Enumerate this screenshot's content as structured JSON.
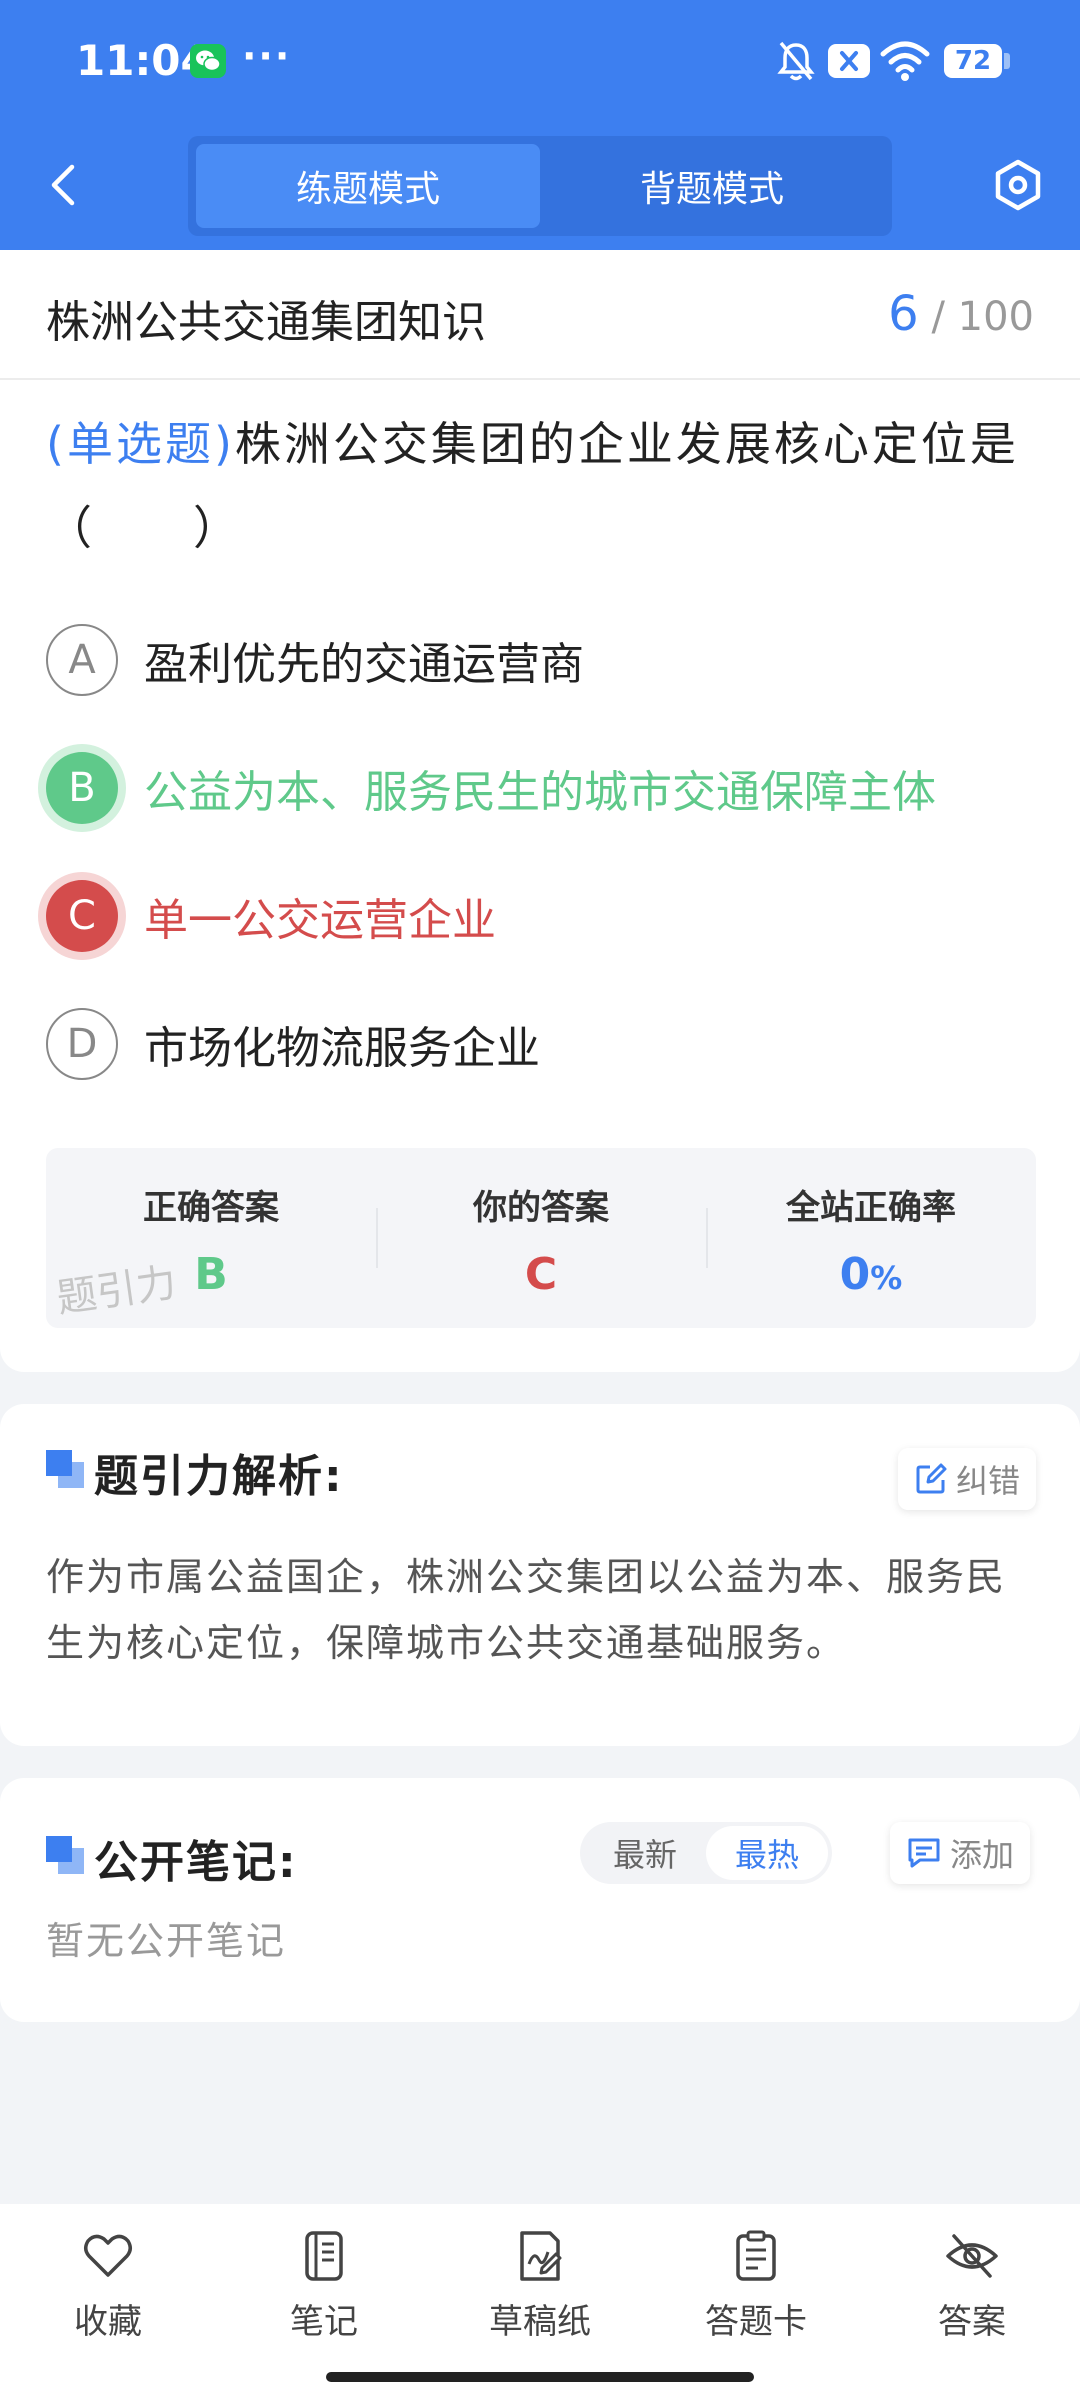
{
  "status_bar": {
    "time": "11:04",
    "dots": "···",
    "battery": "72",
    "icons": [
      "wechat-icon",
      "bell-off-icon",
      "close-box-icon",
      "wifi-icon",
      "battery-icon"
    ]
  },
  "header": {
    "back_icon": "chevron-left-icon",
    "tabs": [
      {
        "label": "练题模式",
        "active": true
      },
      {
        "label": "背题模式",
        "active": false
      }
    ],
    "settings_icon": "hexagon-settings-icon",
    "color": "#3d7ff0"
  },
  "topic": {
    "title": "株洲公共交通集团知识",
    "current": "6",
    "separator": "/",
    "total": "100"
  },
  "question": {
    "type": "(单选题)",
    "text": "株洲公交集团的企业发展核心定位是（　　）",
    "options": [
      {
        "letter": "A",
        "text": "盈利优先的交通运营商",
        "state": "normal"
      },
      {
        "letter": "B",
        "text": "公益为本、服务民生的城市交通保障主体",
        "state": "correct"
      },
      {
        "letter": "C",
        "text": "单一公交运营企业",
        "state": "wrong"
      },
      {
        "letter": "D",
        "text": "市场化物流服务企业",
        "state": "normal"
      }
    ]
  },
  "answers": {
    "correct_label": "正确答案",
    "correct_value": "B",
    "yours_label": "你的答案",
    "yours_value": "C",
    "rate_label": "全站正确率",
    "rate_value": "0",
    "rate_unit": "%",
    "watermark": "题引力",
    "colors": {
      "correct": "#5fc98a",
      "wrong": "#d44c4c",
      "accent": "#3d7ff0"
    }
  },
  "analysis": {
    "title": "题引力解析:",
    "report_label": "纠错",
    "text": "作为市属公益国企，株洲公交集团以公益为本、服务民生为核心定位，保障城市公共交通基础服务。"
  },
  "notes": {
    "title": "公开笔记:",
    "sort_options": [
      {
        "label": "最新",
        "active": false
      },
      {
        "label": "最热",
        "active": true
      }
    ],
    "add_label": "添加",
    "empty_text": "暂无公开笔记"
  },
  "bottom_nav": [
    {
      "label": "收藏",
      "icon": "heart-icon"
    },
    {
      "label": "笔记",
      "icon": "notebook-icon"
    },
    {
      "label": "草稿纸",
      "icon": "draft-paper-icon"
    },
    {
      "label": "答题卡",
      "icon": "answer-card-icon"
    },
    {
      "label": "答案",
      "icon": "eye-off-icon"
    }
  ]
}
